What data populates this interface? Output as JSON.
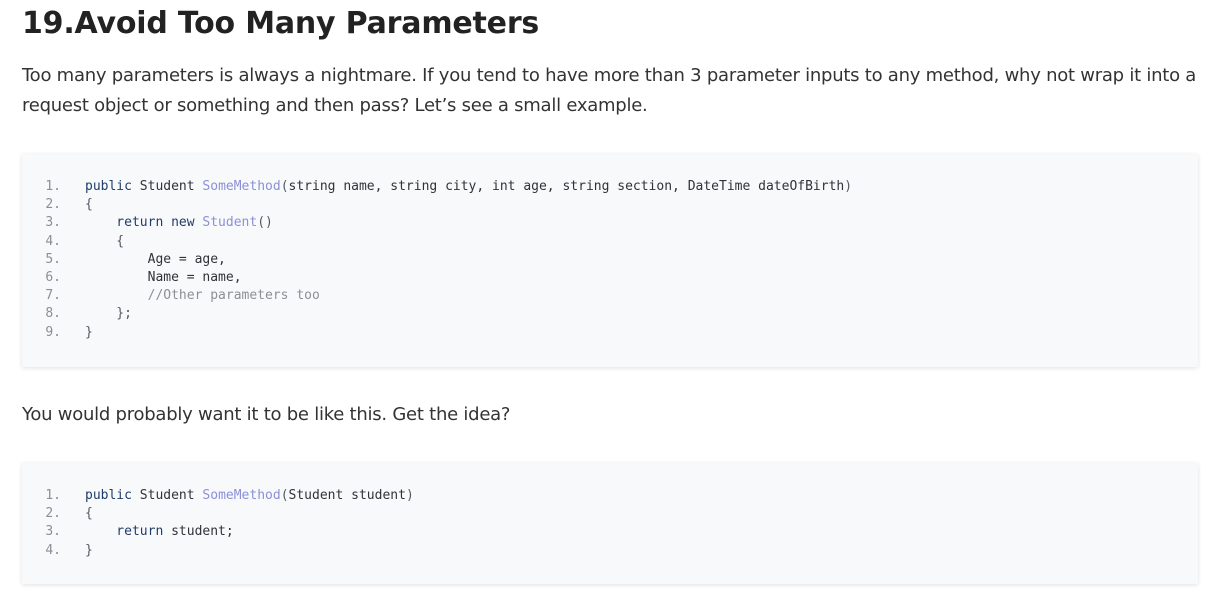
{
  "article": {
    "heading": "19.Avoid Too Many Parameters",
    "intro": "Too many parameters is always a nightmare. If you tend to have more than 3 parameter inputs to any method, why not wrap it into a request object or something and then pass? Let’s see a small example.",
    "followup": "You would probably want it to be like this. Get the idea?"
  },
  "code_blocks": [
    {
      "lines": [
        {
          "num": "1.",
          "tokens": [
            {
              "t": "public ",
              "c": "kw"
            },
            {
              "t": "Student ",
              "c": "src"
            },
            {
              "t": "SomeMethod",
              "c": "fn"
            },
            {
              "t": "(",
              "c": "punc"
            },
            {
              "t": "string name, string city, int age, string section, DateTime dateOfBirth",
              "c": "src"
            },
            {
              "t": ")",
              "c": "punc"
            }
          ]
        },
        {
          "num": "2.",
          "tokens": [
            {
              "t": "{",
              "c": "punc"
            }
          ]
        },
        {
          "num": "3.",
          "tokens": [
            {
              "t": "    return ",
              "c": "kw"
            },
            {
              "t": "new ",
              "c": "kw"
            },
            {
              "t": "Student",
              "c": "fn"
            },
            {
              "t": "()",
              "c": "punc"
            }
          ]
        },
        {
          "num": "4.",
          "tokens": [
            {
              "t": "    {",
              "c": "punc"
            }
          ]
        },
        {
          "num": "5.",
          "tokens": [
            {
              "t": "        Age = age,",
              "c": "src"
            }
          ]
        },
        {
          "num": "6.",
          "tokens": [
            {
              "t": "        Name = name,",
              "c": "src"
            }
          ]
        },
        {
          "num": "7.",
          "tokens": [
            {
              "t": "        //Other parameters too",
              "c": "cm"
            }
          ]
        },
        {
          "num": "8.",
          "tokens": [
            {
              "t": "    };",
              "c": "punc"
            }
          ]
        },
        {
          "num": "9.",
          "tokens": [
            {
              "t": "}",
              "c": "punc"
            }
          ]
        }
      ]
    },
    {
      "lines": [
        {
          "num": "1.",
          "tokens": [
            {
              "t": "public ",
              "c": "kw"
            },
            {
              "t": "Student ",
              "c": "src"
            },
            {
              "t": "SomeMethod",
              "c": "fn"
            },
            {
              "t": "(",
              "c": "punc"
            },
            {
              "t": "Student student",
              "c": "src"
            },
            {
              "t": ")",
              "c": "punc"
            }
          ]
        },
        {
          "num": "2.",
          "tokens": [
            {
              "t": "{",
              "c": "punc"
            }
          ]
        },
        {
          "num": "3.",
          "tokens": [
            {
              "t": "    return ",
              "c": "kw"
            },
            {
              "t": "student;",
              "c": "src"
            }
          ]
        },
        {
          "num": "4.",
          "tokens": [
            {
              "t": "}",
              "c": "punc"
            }
          ]
        }
      ]
    }
  ]
}
